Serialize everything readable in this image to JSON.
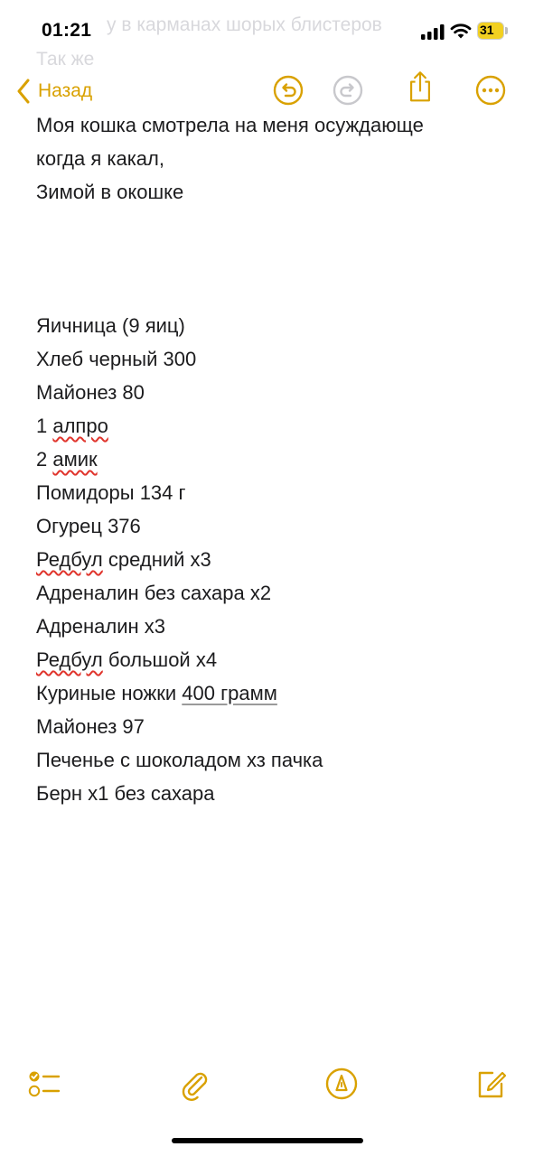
{
  "status_bar": {
    "time": "01:21",
    "battery": "31",
    "background_text": [
      "у в карманах шорых блистеров",
      "Так же"
    ]
  },
  "nav": {
    "back_label": "Назад",
    "icons": [
      "undo-icon",
      "redo-icon",
      "share-icon",
      "more-icon"
    ]
  },
  "accent_color": "#d9a100",
  "note": {
    "intro": [
      "Моя кошка смотрела на меня осуждающе",
      "когда я какал,",
      "Зимой в окошке"
    ],
    "items": [
      {
        "before": "Яичница (9 яиц)"
      },
      {
        "before": "Хлеб черный 300"
      },
      {
        "before": "Майонез 80"
      },
      {
        "before": "1 ",
        "spell": "алпро"
      },
      {
        "before": "2 ",
        "spell": "амик"
      },
      {
        "before": "Помидоры 134 г"
      },
      {
        "before": "Огурец 376"
      },
      {
        "spell": "Редбул",
        "after": " средний х3"
      },
      {
        "before": "Адреналин без сахара х2"
      },
      {
        "before": "Адреналин х3"
      },
      {
        "spell": "Редбул",
        "after": " большой х4"
      },
      {
        "before": "Куриные ножки ",
        "link": "400 грамм"
      },
      {
        "before": "Майонез 97"
      },
      {
        "before": "Печенье с шоколадом хз пачка"
      },
      {
        "before": "Берн х1 без сахара"
      }
    ]
  },
  "toolbar": {
    "icons": [
      "checklist-icon",
      "attachment-icon",
      "markup-icon",
      "compose-icon"
    ]
  }
}
